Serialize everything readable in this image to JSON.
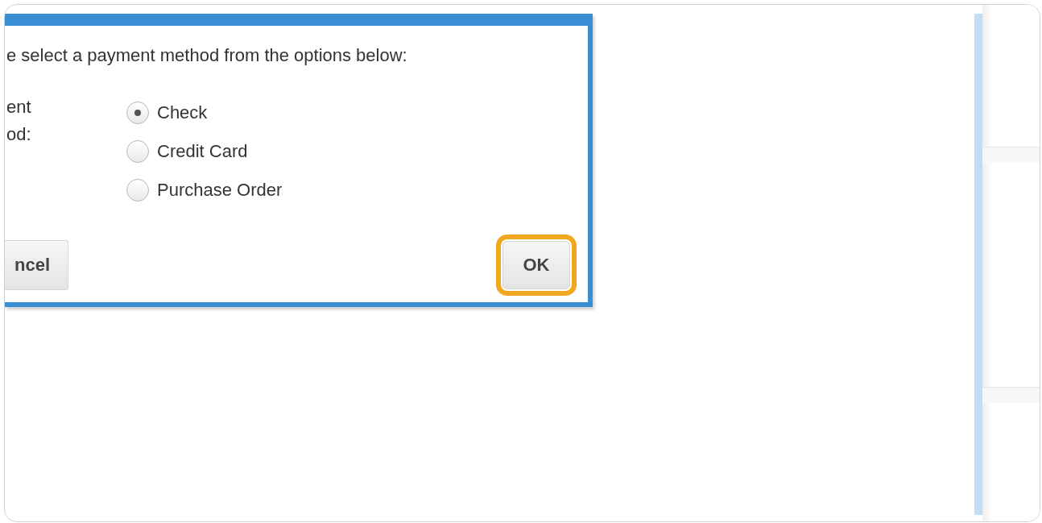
{
  "dialog": {
    "instruction": "e select a payment method from the options below:",
    "field_label": "ent\nod:",
    "options": [
      {
        "label": "Check",
        "selected": true
      },
      {
        "label": "Credit Card",
        "selected": false
      },
      {
        "label": "Purchase Order",
        "selected": false
      }
    ],
    "buttons": [
      {
        "label": "ncel",
        "kind": "cancel",
        "highlighted": false
      },
      {
        "label": "OK",
        "kind": "ok",
        "highlighted": true
      }
    ]
  }
}
